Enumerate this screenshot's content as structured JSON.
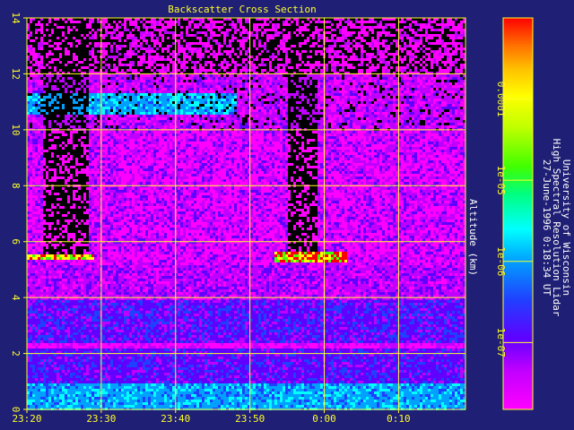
{
  "chart_data": {
    "type": "heatmap",
    "title": "Backscatter Cross Section",
    "ylabel": "Altitude (km)",
    "xlabel": "",
    "x_tick_labels": [
      "23:20",
      "23:30",
      "23:40",
      "23:50",
      "0:00",
      "0:10"
    ],
    "x_range_minutes": [
      0,
      59
    ],
    "x_tick_minutes": [
      0,
      10,
      20,
      30,
      40,
      50
    ],
    "ylim": [
      0,
      14
    ],
    "y_ticks": [
      0,
      2,
      4,
      6,
      8,
      10,
      12,
      14
    ],
    "grid": true,
    "colorbar": {
      "scale": "log",
      "range": [
        1.5e-08,
        0.001
      ],
      "tick_values": [
        0.0001,
        1e-05,
        1e-06,
        1e-07
      ],
      "tick_labels": [
        "0.0001",
        "1e-05",
        "1e-06",
        "1e-07"
      ],
      "colors": [
        "#ff00ff",
        "#c000ff",
        "#6000ff",
        "#2040ff",
        "#00a0ff",
        "#00ffff",
        "#00ff80",
        "#40ff00",
        "#c0ff00",
        "#ffff00",
        "#ffc000",
        "#ff7000",
        "#ff0000"
      ]
    },
    "features": [
      {
        "name": "boundary layer",
        "altitude_km": [
          0.3,
          1.0
        ],
        "level": "1e-06"
      },
      {
        "name": "cirrus layer",
        "minutes": [
          0,
          28
        ],
        "altitude_km": [
          10.6,
          11.4
        ],
        "level": "1e-06"
      },
      {
        "name": "cloud layer",
        "minutes": [
          0,
          9
        ],
        "altitude_km": [
          5.4,
          5.6
        ],
        "level": "1e-05"
      },
      {
        "name": "cloud layer",
        "minutes": [
          33,
          43
        ],
        "altitude_km": [
          5.3,
          5.7
        ],
        "level": "1e-05"
      },
      {
        "name": "attenuated column",
        "minutes": [
          2,
          8
        ],
        "altitude_km": [
          5.6,
          14
        ]
      },
      {
        "name": "attenuated column",
        "minutes": [
          35,
          39
        ],
        "altitude_km": [
          5.7,
          14
        ]
      }
    ],
    "side_text": [
      "University of Wisconsin",
      "High Spectral Resolution Lidar",
      "27-June-1996  0:18:34 UT"
    ]
  },
  "colors": {
    "background": "#1f1f75",
    "axes": "#ffff2a",
    "grid": "#ffff2a",
    "text": "#ffffff"
  }
}
